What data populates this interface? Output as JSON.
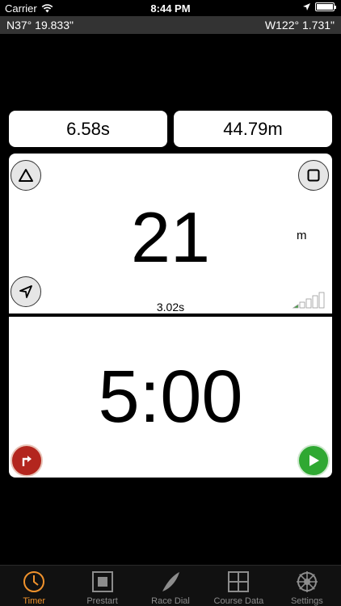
{
  "status_bar": {
    "carrier": "Carrier",
    "time": "8:44 PM",
    "icons": [
      "wifi-icon",
      "location-arrow-icon",
      "battery-icon"
    ]
  },
  "coordinates": {
    "latitude": "N37° 19.833\"",
    "longitude": "W122° 1.731\""
  },
  "stats": {
    "left_value": "6.58s",
    "right_value": "44.79m"
  },
  "distance_panel": {
    "value": "21",
    "unit": "m",
    "time": "3.02s",
    "signal_bars_filled": 1,
    "signal_bars_total": 5,
    "signal_color": "#3aa53a",
    "icons": [
      "triangle-icon",
      "stop-icon",
      "navigation-arrow-icon",
      "signal-strength-icon"
    ]
  },
  "timer_panel": {
    "countdown": "5:00",
    "turn_color": "#b3261e",
    "play_color": "#2fa832",
    "icons": [
      "turn-right-icon",
      "play-icon"
    ]
  },
  "tabs": [
    {
      "label": "Timer",
      "icon": "clock-icon",
      "active": true
    },
    {
      "label": "Prestart",
      "icon": "square-icon",
      "active": false
    },
    {
      "label": "Race Dial",
      "icon": "sail-icon",
      "active": false
    },
    {
      "label": "Course Data",
      "icon": "grid-icon",
      "active": false
    },
    {
      "label": "Settings",
      "icon": "helm-wheel-icon",
      "active": false
    }
  ],
  "accent_color": "#f0922c"
}
